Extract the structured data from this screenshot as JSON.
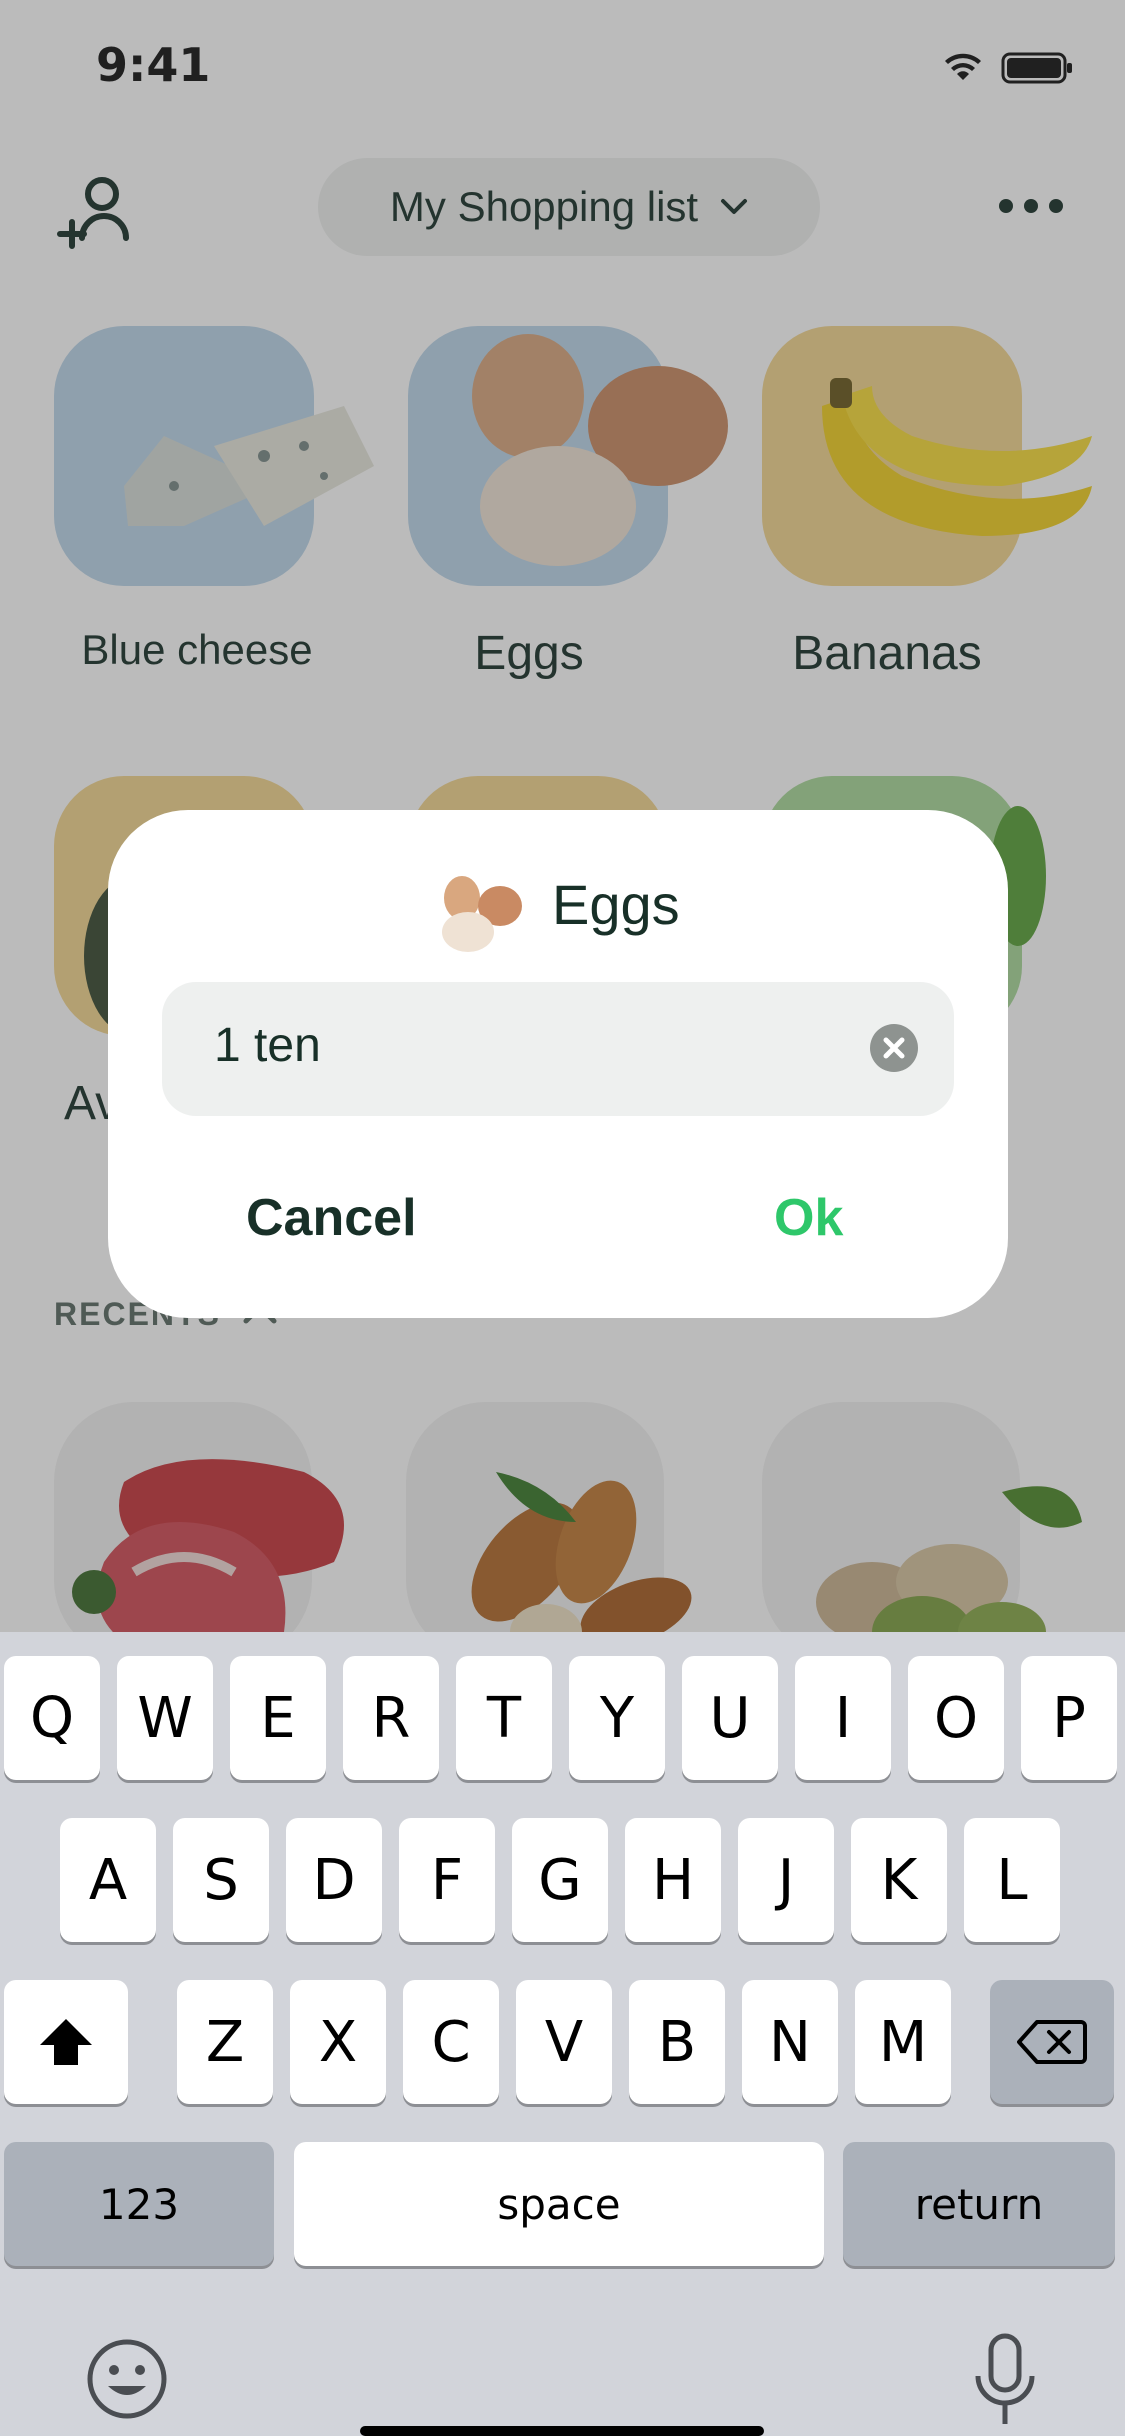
{
  "status": {
    "time": "9:41"
  },
  "header": {
    "list_title": "My Shopping list"
  },
  "tiles": [
    {
      "label": "Blue cheese",
      "bg": "#bcd6ea"
    },
    {
      "label": "Eggs",
      "bg": "#bcd6ea"
    },
    {
      "label": "Bananas",
      "bg": "#f3d68f"
    },
    {
      "label": "Av",
      "bg": "#f3d68f"
    },
    {
      "label": "",
      "bg": "#f3d68f"
    },
    {
      "label": "",
      "bg": "#a9d99a"
    }
  ],
  "recents": {
    "label": "RECENTS"
  },
  "dialog": {
    "title": "Eggs",
    "field_value": "1 ten",
    "cancel_label": "Cancel",
    "ok_label": "Ok"
  },
  "keyboard": {
    "row1": [
      "Q",
      "W",
      "E",
      "R",
      "T",
      "Y",
      "U",
      "I",
      "O",
      "P"
    ],
    "row2": [
      "A",
      "S",
      "D",
      "F",
      "G",
      "H",
      "J",
      "K",
      "L"
    ],
    "row3": [
      "Z",
      "X",
      "C",
      "V",
      "B",
      "N",
      "M"
    ],
    "numbers_label": "123",
    "space_label": "space",
    "return_label": "return"
  },
  "colors": {
    "accent_ok": "#2ec76a",
    "text_dark": "#183028",
    "overlay": "rgba(60,60,60,0.35)"
  }
}
